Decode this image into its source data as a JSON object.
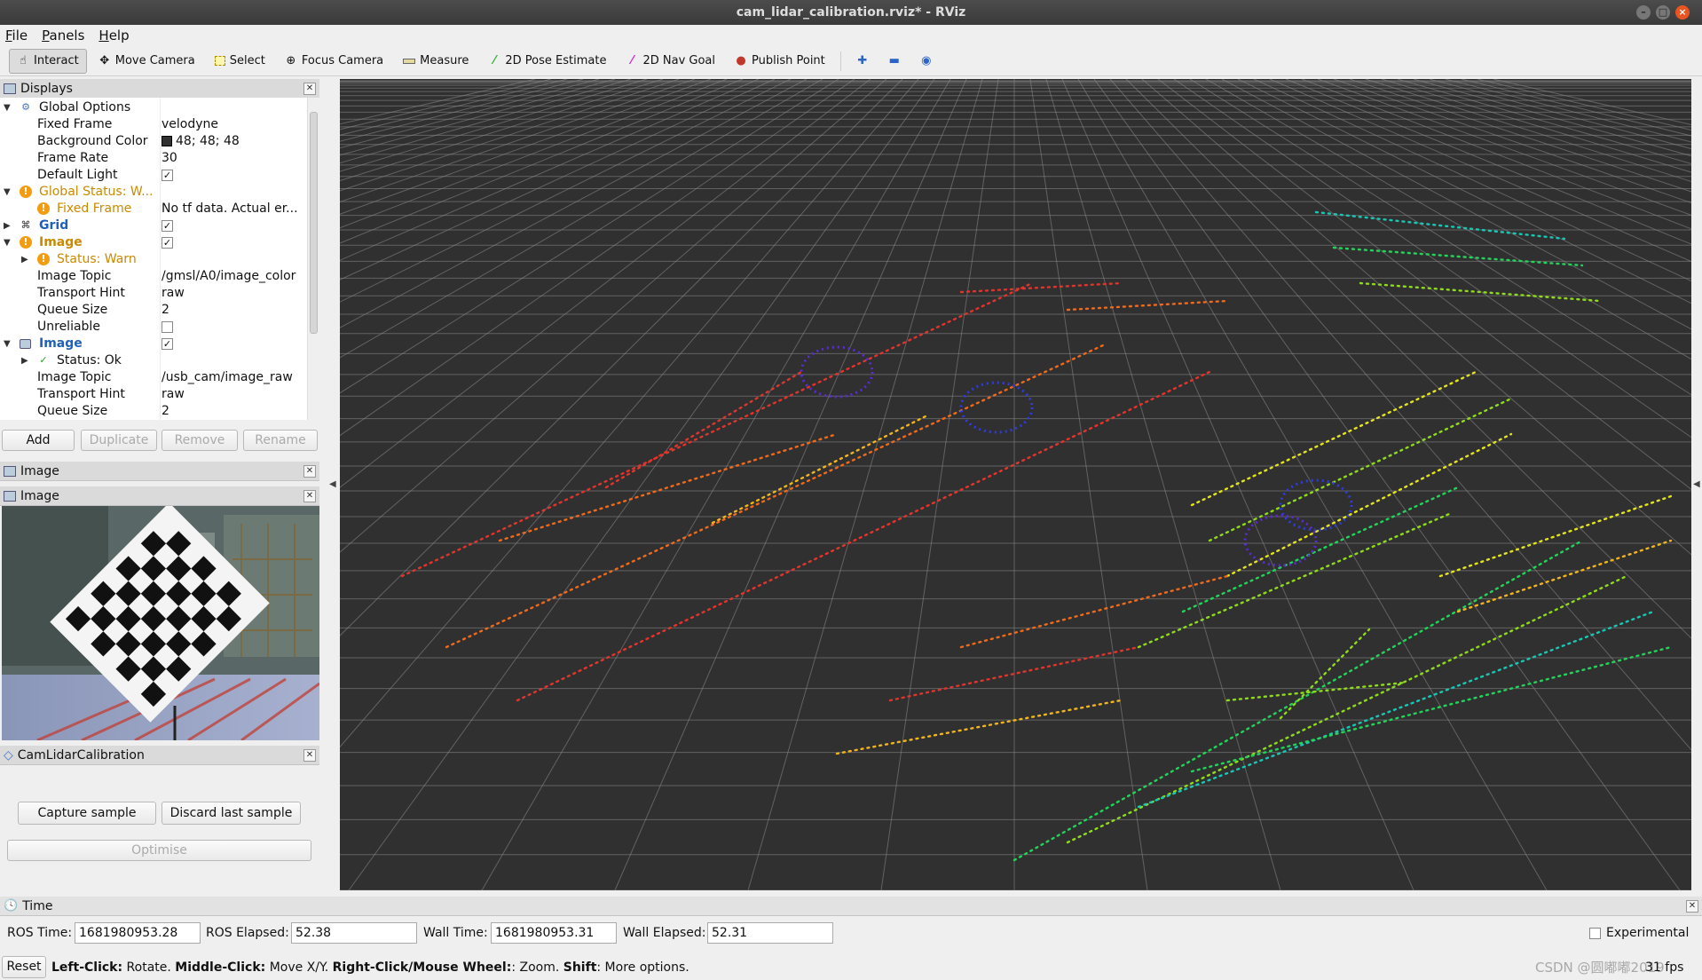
{
  "window": {
    "title": "cam_lidar_calibration.rviz* - RViz"
  },
  "menu": [
    "File",
    "Panels",
    "Help"
  ],
  "toolbar": {
    "tools": [
      {
        "label": "Interact",
        "icon": "interact-icon",
        "active": true
      },
      {
        "label": "Move Camera",
        "icon": "move-camera-icon"
      },
      {
        "label": "Select",
        "icon": "select-icon"
      },
      {
        "label": "Focus Camera",
        "icon": "focus-camera-icon"
      },
      {
        "label": "Measure",
        "icon": "measure-icon"
      },
      {
        "label": "2D Pose Estimate",
        "icon": "pose-estimate-icon"
      },
      {
        "label": "2D Nav Goal",
        "icon": "nav-goal-icon"
      },
      {
        "label": "Publish Point",
        "icon": "publish-point-icon"
      }
    ],
    "extra_icons": [
      "add-tool-icon",
      "remove-tool-icon",
      "camera-type-icon"
    ]
  },
  "displays": {
    "title": "Displays",
    "rows": [
      {
        "label": "Global Options",
        "value": ""
      },
      {
        "label": "Fixed Frame",
        "value": "velodyne"
      },
      {
        "label": "Background Color",
        "value": "48; 48; 48"
      },
      {
        "label": "Frame Rate",
        "value": "30"
      },
      {
        "label": "Default Light",
        "value": ""
      },
      {
        "label": "Global Status: W...",
        "value": ""
      },
      {
        "label": "Fixed Frame",
        "value": "No tf data.  Actual er..."
      },
      {
        "label": "Grid",
        "value": ""
      },
      {
        "label": "Image",
        "value": ""
      },
      {
        "label": "Status: Warn",
        "value": ""
      },
      {
        "label": "Image Topic",
        "value": "/gmsl/A0/image_color"
      },
      {
        "label": "Transport Hint",
        "value": "raw"
      },
      {
        "label": "Queue Size",
        "value": "2"
      },
      {
        "label": "Unreliable",
        "value": ""
      },
      {
        "label": "Image",
        "value": ""
      },
      {
        "label": "Status: Ok",
        "value": ""
      },
      {
        "label": "Image Topic",
        "value": "/usb_cam/image_raw"
      },
      {
        "label": "Transport Hint",
        "value": "raw"
      },
      {
        "label": "Queue Size",
        "value": "2"
      }
    ],
    "checks": {
      "default_light": true,
      "grid": true,
      "image1": true,
      "unreliable": false,
      "image2": true
    },
    "buttons": {
      "add": "Add",
      "duplicate": "Duplicate",
      "remove": "Remove",
      "rename": "Rename"
    }
  },
  "image_panels": {
    "first_title": "Image",
    "second_title": "Image"
  },
  "calibration": {
    "title": "CamLidarCalibration",
    "capture": "Capture sample",
    "discard": "Discard last sample",
    "optimise": "Optimise"
  },
  "time": {
    "title": "Time",
    "ros_time_label": "ROS Time:",
    "ros_time": "1681980953.28",
    "ros_elapsed_label": "ROS Elapsed:",
    "ros_elapsed": "52.38",
    "wall_time_label": "Wall Time:",
    "wall_time": "1681980953.31",
    "wall_elapsed_label": "Wall Elapsed:",
    "wall_elapsed": "52.31",
    "experimental": "Experimental"
  },
  "status": {
    "reset": "Reset",
    "left_click": "Left-Click:",
    "left_click_desc": " Rotate. ",
    "middle_click": "Middle-Click:",
    "middle_click_desc": " Move X/Y. ",
    "right_click": "Right-Click/Mouse Wheel:",
    "right_click_desc": ": Zoom. ",
    "shift": "Shift",
    "shift_desc": ": More options.",
    "fps": "31 fps",
    "watermark": "CSDN @圆嘟嘟2019"
  },
  "colors": {
    "viewport_bg": "#303030",
    "warn": "#c98a00",
    "display_blue": "#1f61b8"
  }
}
